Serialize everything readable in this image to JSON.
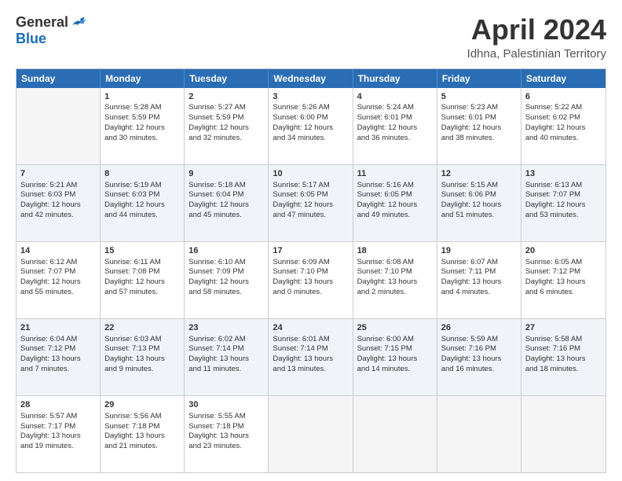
{
  "logo": {
    "general": "General",
    "blue": "Blue"
  },
  "header": {
    "title": "April 2024",
    "subtitle": "Idhna, Palestinian Territory"
  },
  "days": [
    "Sunday",
    "Monday",
    "Tuesday",
    "Wednesday",
    "Thursday",
    "Friday",
    "Saturday"
  ],
  "rows": [
    [
      {
        "day": "",
        "lines": []
      },
      {
        "day": "1",
        "lines": [
          "Sunrise: 5:28 AM",
          "Sunset: 5:59 PM",
          "Daylight: 12 hours",
          "and 30 minutes."
        ]
      },
      {
        "day": "2",
        "lines": [
          "Sunrise: 5:27 AM",
          "Sunset: 5:59 PM",
          "Daylight: 12 hours",
          "and 32 minutes."
        ]
      },
      {
        "day": "3",
        "lines": [
          "Sunrise: 5:26 AM",
          "Sunset: 6:00 PM",
          "Daylight: 12 hours",
          "and 34 minutes."
        ]
      },
      {
        "day": "4",
        "lines": [
          "Sunrise: 5:24 AM",
          "Sunset: 6:01 PM",
          "Daylight: 12 hours",
          "and 36 minutes."
        ]
      },
      {
        "day": "5",
        "lines": [
          "Sunrise: 5:23 AM",
          "Sunset: 6:01 PM",
          "Daylight: 12 hours",
          "and 38 minutes."
        ]
      },
      {
        "day": "6",
        "lines": [
          "Sunrise: 5:22 AM",
          "Sunset: 6:02 PM",
          "Daylight: 12 hours",
          "and 40 minutes."
        ]
      }
    ],
    [
      {
        "day": "7",
        "lines": [
          "Sunrise: 5:21 AM",
          "Sunset: 6:03 PM",
          "Daylight: 12 hours",
          "and 42 minutes."
        ]
      },
      {
        "day": "8",
        "lines": [
          "Sunrise: 5:19 AM",
          "Sunset: 6:03 PM",
          "Daylight: 12 hours",
          "and 44 minutes."
        ]
      },
      {
        "day": "9",
        "lines": [
          "Sunrise: 5:18 AM",
          "Sunset: 6:04 PM",
          "Daylight: 12 hours",
          "and 45 minutes."
        ]
      },
      {
        "day": "10",
        "lines": [
          "Sunrise: 5:17 AM",
          "Sunset: 6:05 PM",
          "Daylight: 12 hours",
          "and 47 minutes."
        ]
      },
      {
        "day": "11",
        "lines": [
          "Sunrise: 5:16 AM",
          "Sunset: 6:05 PM",
          "Daylight: 12 hours",
          "and 49 minutes."
        ]
      },
      {
        "day": "12",
        "lines": [
          "Sunrise: 5:15 AM",
          "Sunset: 6:06 PM",
          "Daylight: 12 hours",
          "and 51 minutes."
        ]
      },
      {
        "day": "13",
        "lines": [
          "Sunrise: 6:13 AM",
          "Sunset: 7:07 PM",
          "Daylight: 12 hours",
          "and 53 minutes."
        ]
      }
    ],
    [
      {
        "day": "14",
        "lines": [
          "Sunrise: 6:12 AM",
          "Sunset: 7:07 PM",
          "Daylight: 12 hours",
          "and 55 minutes."
        ]
      },
      {
        "day": "15",
        "lines": [
          "Sunrise: 6:11 AM",
          "Sunset: 7:08 PM",
          "Daylight: 12 hours",
          "and 57 minutes."
        ]
      },
      {
        "day": "16",
        "lines": [
          "Sunrise: 6:10 AM",
          "Sunset: 7:09 PM",
          "Daylight: 12 hours",
          "and 58 minutes."
        ]
      },
      {
        "day": "17",
        "lines": [
          "Sunrise: 6:09 AM",
          "Sunset: 7:10 PM",
          "Daylight: 13 hours",
          "and 0 minutes."
        ]
      },
      {
        "day": "18",
        "lines": [
          "Sunrise: 6:08 AM",
          "Sunset: 7:10 PM",
          "Daylight: 13 hours",
          "and 2 minutes."
        ]
      },
      {
        "day": "19",
        "lines": [
          "Sunrise: 6:07 AM",
          "Sunset: 7:11 PM",
          "Daylight: 13 hours",
          "and 4 minutes."
        ]
      },
      {
        "day": "20",
        "lines": [
          "Sunrise: 6:05 AM",
          "Sunset: 7:12 PM",
          "Daylight: 13 hours",
          "and 6 minutes."
        ]
      }
    ],
    [
      {
        "day": "21",
        "lines": [
          "Sunrise: 6:04 AM",
          "Sunset: 7:12 PM",
          "Daylight: 13 hours",
          "and 7 minutes."
        ]
      },
      {
        "day": "22",
        "lines": [
          "Sunrise: 6:03 AM",
          "Sunset: 7:13 PM",
          "Daylight: 13 hours",
          "and 9 minutes."
        ]
      },
      {
        "day": "23",
        "lines": [
          "Sunrise: 6:02 AM",
          "Sunset: 7:14 PM",
          "Daylight: 13 hours",
          "and 11 minutes."
        ]
      },
      {
        "day": "24",
        "lines": [
          "Sunrise: 6:01 AM",
          "Sunset: 7:14 PM",
          "Daylight: 13 hours",
          "and 13 minutes."
        ]
      },
      {
        "day": "25",
        "lines": [
          "Sunrise: 6:00 AM",
          "Sunset: 7:15 PM",
          "Daylight: 13 hours",
          "and 14 minutes."
        ]
      },
      {
        "day": "26",
        "lines": [
          "Sunrise: 5:59 AM",
          "Sunset: 7:16 PM",
          "Daylight: 13 hours",
          "and 16 minutes."
        ]
      },
      {
        "day": "27",
        "lines": [
          "Sunrise: 5:58 AM",
          "Sunset: 7:16 PM",
          "Daylight: 13 hours",
          "and 18 minutes."
        ]
      }
    ],
    [
      {
        "day": "28",
        "lines": [
          "Sunrise: 5:57 AM",
          "Sunset: 7:17 PM",
          "Daylight: 13 hours",
          "and 19 minutes."
        ]
      },
      {
        "day": "29",
        "lines": [
          "Sunrise: 5:56 AM",
          "Sunset: 7:18 PM",
          "Daylight: 13 hours",
          "and 21 minutes."
        ]
      },
      {
        "day": "30",
        "lines": [
          "Sunrise: 5:55 AM",
          "Sunset: 7:18 PM",
          "Daylight: 13 hours",
          "and 23 minutes."
        ]
      },
      {
        "day": "",
        "lines": []
      },
      {
        "day": "",
        "lines": []
      },
      {
        "day": "",
        "lines": []
      },
      {
        "day": "",
        "lines": []
      }
    ]
  ]
}
